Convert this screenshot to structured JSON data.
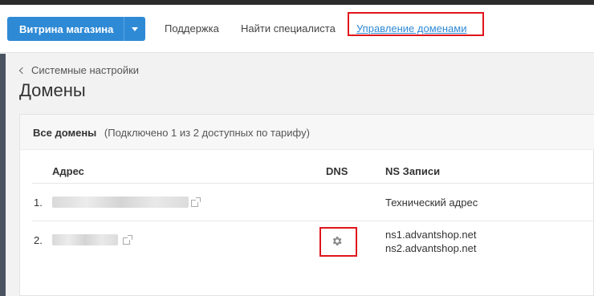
{
  "header": {
    "store_button_label": "Витрина магазина",
    "nav_support": "Поддержка",
    "nav_find_specialist": "Найти специалиста",
    "nav_domain_management": "Управление доменами"
  },
  "breadcrumb": {
    "back_label": "Системные настройки"
  },
  "page_title": "Домены",
  "domains_card": {
    "title": "Все домены",
    "subtitle": "(Подключено 1 из 2 доступных по тарифу)",
    "columns": {
      "address": "Адрес",
      "dns": "DNS",
      "ns_records": "NS Записи"
    },
    "rows": [
      {
        "num": "1.",
        "ns_text": "Технический адрес"
      },
      {
        "num": "2.",
        "ns1": "ns1.advantshop.net",
        "ns2": "ns2.advantshop.net"
      }
    ]
  },
  "colors": {
    "accent": "#2f8ad6",
    "highlight": "#e0151b",
    "sidebar": "#4a5360"
  },
  "icons": [
    "caret-down-icon",
    "chevron-left-icon",
    "external-link-icon",
    "gear-icon"
  ]
}
